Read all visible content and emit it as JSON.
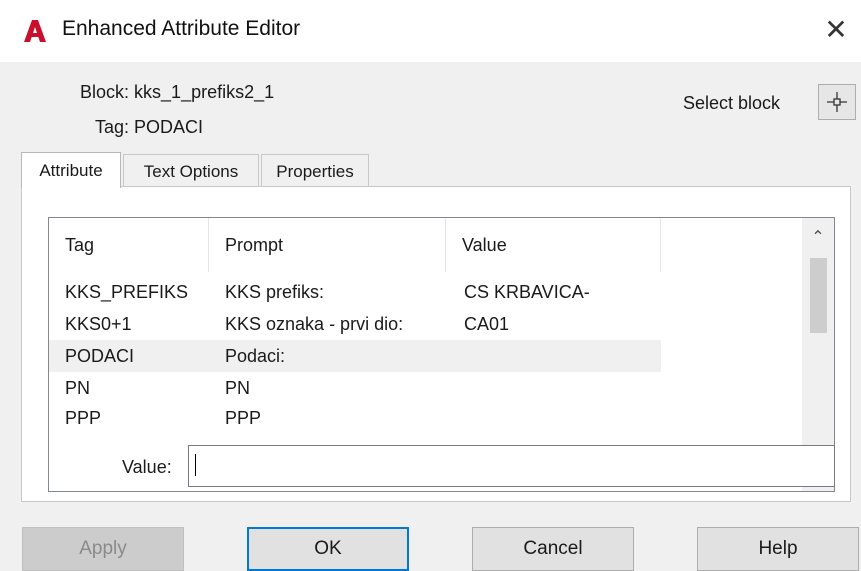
{
  "window": {
    "title": "Enhanced Attribute Editor",
    "close_glyph": "✕",
    "logo_letter": "A",
    "accent_color": "#c8102e"
  },
  "header": {
    "block_label": "Block:",
    "block_value": "kks_1_prefiks2_1",
    "tag_label": "Tag:",
    "tag_value": "PODACI",
    "select_block_label": "Select block",
    "select_block_icon": "crosshair-icon"
  },
  "tabs": [
    {
      "label": "Attribute",
      "active": true
    },
    {
      "label": "Text Options",
      "active": false
    },
    {
      "label": "Properties",
      "active": false
    }
  ],
  "list": {
    "columns": [
      "Tag",
      "Prompt",
      "Value"
    ],
    "rows": [
      {
        "tag": "KKS_PREFIKS",
        "prompt": "KKS prefiks:",
        "value": "CS KRBAVICA-"
      },
      {
        "tag": "KKS0+1",
        "prompt": "KKS oznaka - prvi dio:",
        "value": "CA01"
      },
      {
        "tag": "PODACI",
        "prompt": "Podaci:",
        "value": "",
        "selected": true
      },
      {
        "tag": "PN",
        "prompt": "PN",
        "value": ""
      },
      {
        "tag": "PPP",
        "prompt": "PPP",
        "value": ""
      }
    ],
    "scroll_up_glyph": "⌃",
    "scroll_down_glyph": "⌄"
  },
  "value_field": {
    "label": "Value:",
    "value": ""
  },
  "buttons": {
    "apply": "Apply",
    "ok": "OK",
    "cancel": "Cancel",
    "help": "Help"
  }
}
